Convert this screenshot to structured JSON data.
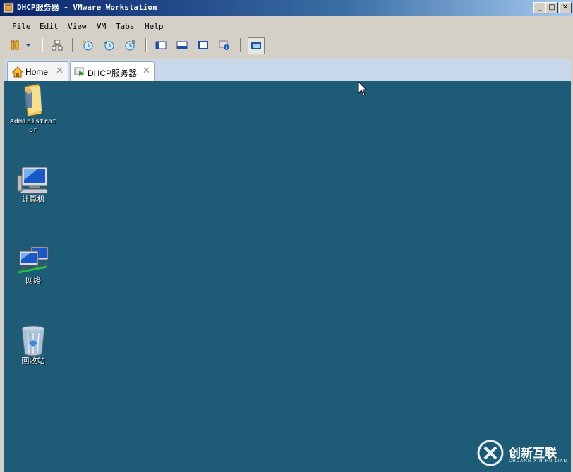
{
  "window": {
    "title": "DHCP服务器 - VMware Workstation",
    "controls": {
      "minimize": "_",
      "maximize": "□",
      "close": "✕"
    }
  },
  "menu": [
    "File",
    "Edit",
    "View",
    "VM",
    "Tabs",
    "Help"
  ],
  "toolbar": {
    "icons": [
      "pause-icon",
      "dropdown-arrow-icon",
      "network-icon",
      "snapshot-take-icon",
      "snapshot-revert-icon",
      "snapshot-manager-icon",
      "console-view-icon",
      "quick-switch-icon",
      "fullscreen-icon",
      "unity-icon",
      "fullscreen-toggle-icon"
    ]
  },
  "tabs": [
    {
      "label": "Home",
      "close": "✕",
      "icon": "home-icon"
    },
    {
      "label": "DHCP服务器",
      "close": "✕",
      "icon": "vm-running-icon"
    }
  ],
  "desktop": {
    "background": "#1e5b76",
    "icons": [
      {
        "label": "Administrator",
        "icon": "user-folder-icon"
      },
      {
        "label": "计算机",
        "icon": "computer-icon"
      },
      {
        "label": "网络",
        "icon": "network-icon"
      },
      {
        "label": "回收站",
        "icon": "recycle-bin-icon"
      }
    ]
  },
  "watermark": {
    "text": "创新互联",
    "subtext": "CHUANG XIN HU LIAN"
  }
}
